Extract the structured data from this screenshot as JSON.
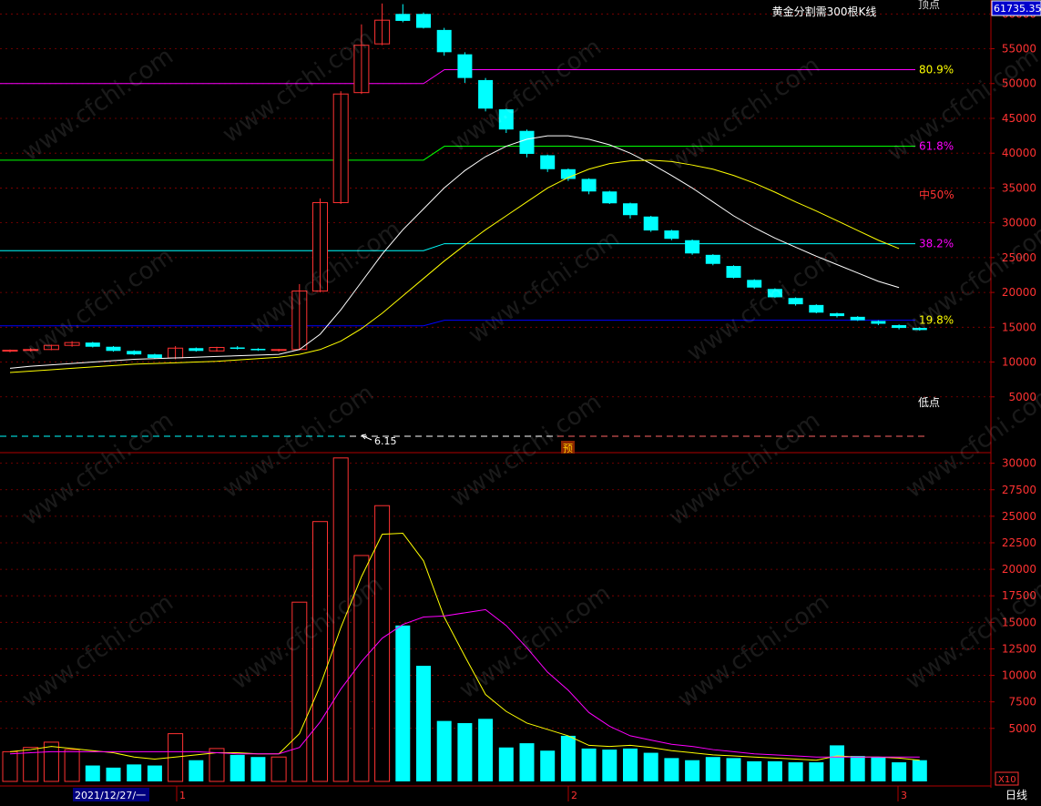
{
  "header": {
    "title": "黄金分割需300根K线",
    "price_badge": "61735.35",
    "top_label_partial": "顶点"
  },
  "watermark": "www.cfchi.com",
  "colors": {
    "background": "#000000",
    "up": "#ff3232",
    "down": "#00ffff",
    "grid": "#8b0000",
    "axis_text": "#ff3232",
    "ma_white": "#ffffff",
    "ma_yellow": "#ffff00",
    "vol_ma_yellow": "#ffff00",
    "vol_ma_magenta": "#ff00ff",
    "fib_809": "#ff00ff",
    "fib_618": "#00ff00",
    "fib_382": "#00ffff",
    "fib_198": "#0000ff"
  },
  "chart_data": [
    {
      "type": "candlestick",
      "ylim": [
        0,
        62000
      ],
      "y_ticks": [
        5000,
        10000,
        15000,
        20000,
        25000,
        30000,
        35000,
        40000,
        45000,
        50000,
        55000,
        60000
      ],
      "grid": true,
      "candles": [
        {
          "o": 11600,
          "h": 11800,
          "l": 11400,
          "c": 11700
        },
        {
          "o": 11700,
          "h": 12000,
          "l": 11500,
          "c": 11800
        },
        {
          "o": 11800,
          "h": 12500,
          "l": 11700,
          "c": 12400
        },
        {
          "o": 12400,
          "h": 13000,
          "l": 12200,
          "c": 12800
        },
        {
          "o": 12800,
          "h": 12900,
          "l": 12100,
          "c": 12200
        },
        {
          "o": 12200,
          "h": 12300,
          "l": 11500,
          "c": 11600
        },
        {
          "o": 11600,
          "h": 11700,
          "l": 11000,
          "c": 11100
        },
        {
          "o": 11100,
          "h": 11200,
          "l": 10500,
          "c": 10600
        },
        {
          "o": 10600,
          "h": 12300,
          "l": 10400,
          "c": 12000
        },
        {
          "o": 12000,
          "h": 12100,
          "l": 11500,
          "c": 11600
        },
        {
          "o": 11600,
          "h": 12200,
          "l": 11500,
          "c": 12100
        },
        {
          "o": 12100,
          "h": 12300,
          "l": 11800,
          "c": 11900
        },
        {
          "o": 11900,
          "h": 12000,
          "l": 11600,
          "c": 11700
        },
        {
          "o": 11700,
          "h": 11900,
          "l": 11500,
          "c": 11800
        },
        {
          "o": 11800,
          "h": 21200,
          "l": 11700,
          "c": 20200
        },
        {
          "o": 20200,
          "h": 33500,
          "l": 20000,
          "c": 32900
        },
        {
          "o": 32900,
          "h": 48900,
          "l": 32700,
          "c": 48500
        },
        {
          "o": 48700,
          "h": 58500,
          "l": 48500,
          "c": 55500
        },
        {
          "o": 55700,
          "h": 61500,
          "l": 55500,
          "c": 59100
        },
        {
          "o": 60000,
          "h": 61400,
          "l": 58800,
          "c": 59000
        },
        {
          "o": 60000,
          "h": 60200,
          "l": 57900,
          "c": 58000
        },
        {
          "o": 57700,
          "h": 58000,
          "l": 54000,
          "c": 54500
        },
        {
          "o": 54200,
          "h": 54500,
          "l": 50100,
          "c": 50800
        },
        {
          "o": 50500,
          "h": 50800,
          "l": 46000,
          "c": 46400
        },
        {
          "o": 46300,
          "h": 46400,
          "l": 42900,
          "c": 43400
        },
        {
          "o": 43200,
          "h": 43400,
          "l": 39400,
          "c": 39900
        },
        {
          "o": 39700,
          "h": 39800,
          "l": 37300,
          "c": 37700
        },
        {
          "o": 37700,
          "h": 37800,
          "l": 36000,
          "c": 36300
        },
        {
          "o": 36300,
          "h": 36400,
          "l": 34100,
          "c": 34500
        },
        {
          "o": 34500,
          "h": 34600,
          "l": 32700,
          "c": 32800
        },
        {
          "o": 32800,
          "h": 32900,
          "l": 30600,
          "c": 31100
        },
        {
          "o": 30900,
          "h": 31000,
          "l": 28700,
          "c": 28900
        },
        {
          "o": 28900,
          "h": 29000,
          "l": 27500,
          "c": 27700
        },
        {
          "o": 27500,
          "h": 27600,
          "l": 25400,
          "c": 25600
        },
        {
          "o": 25400,
          "h": 25500,
          "l": 23900,
          "c": 24100
        },
        {
          "o": 23800,
          "h": 23900,
          "l": 22000,
          "c": 22100
        },
        {
          "o": 21800,
          "h": 21900,
          "l": 20500,
          "c": 20700
        },
        {
          "o": 20500,
          "h": 20600,
          "l": 19200,
          "c": 19300
        },
        {
          "o": 19200,
          "h": 19300,
          "l": 18100,
          "c": 18300
        },
        {
          "o": 18200,
          "h": 18300,
          "l": 17000,
          "c": 17100
        },
        {
          "o": 17000,
          "h": 17100,
          "l": 16400,
          "c": 16600
        },
        {
          "o": 16500,
          "h": 16600,
          "l": 15900,
          "c": 16000
        },
        {
          "o": 15900,
          "h": 16000,
          "l": 15300,
          "c": 15500
        },
        {
          "o": 15300,
          "h": 15400,
          "l": 14700,
          "c": 14900
        },
        {
          "o": 14900,
          "h": 15000,
          "l": 14500,
          "c": 14600
        }
      ],
      "ma_white": [
        9100,
        9400,
        9600,
        9800,
        10000,
        10200,
        10400,
        10500,
        10600,
        10700,
        10800,
        10900,
        11000,
        11100,
        11800,
        14000,
        17500,
        21500,
        25500,
        29000,
        32000,
        35000,
        37500,
        39500,
        41000,
        42000,
        42500,
        42500,
        42000,
        41200,
        40000,
        38500,
        36800,
        35000,
        33000,
        31000,
        29300,
        27800,
        26500,
        25200,
        24000,
        22800,
        21600,
        20700
      ],
      "ma_yellow": [
        8500,
        8700,
        8900,
        9100,
        9300,
        9500,
        9700,
        9800,
        9900,
        10000,
        10100,
        10300,
        10500,
        10700,
        11100,
        11800,
        13000,
        14800,
        17000,
        19500,
        22000,
        24500,
        26800,
        29000,
        31000,
        33000,
        35000,
        36500,
        37700,
        38500,
        38900,
        39000,
        38800,
        38300,
        37700,
        36800,
        35700,
        34400,
        33000,
        31700,
        30300,
        28900,
        27500,
        26300
      ],
      "fib_levels": [
        {
          "label": "80.9%",
          "value": 52000,
          "left_value": 50000
        },
        {
          "label": "61.8%",
          "value": 41000,
          "left_value": 39000
        },
        {
          "label": "中50%",
          "value": 34000
        },
        {
          "label": "38.2%",
          "value": 27000,
          "left_value": 26000
        },
        {
          "label": "19.8%",
          "value": 16000,
          "left_value": 15200
        }
      ],
      "low_label": "低点",
      "low_value": "6.15",
      "forecast_marker": "预"
    },
    {
      "type": "bar",
      "title": "",
      "ylim": [
        0,
        31000
      ],
      "y_ticks": [
        5000,
        7500,
        10000,
        12500,
        15000,
        17500,
        20000,
        22500,
        25000,
        27500,
        30000
      ],
      "multiplier_label": "X10",
      "values": [
        2800,
        3200,
        3700,
        3000,
        1500,
        1300,
        1600,
        1500,
        4500,
        2000,
        3100,
        2500,
        2300,
        2300,
        16900,
        24500,
        30500,
        21300,
        26000,
        14700,
        10900,
        5700,
        5500,
        5900,
        3200,
        3600,
        2900,
        4300,
        3100,
        3000,
        3100,
        2700,
        2200,
        2000,
        2300,
        2200,
        1900,
        1900,
        1800,
        1800,
        3400,
        2400,
        2300,
        1800,
        2000
      ],
      "ma_yellow": [
        2800,
        3000,
        3300,
        3100,
        2900,
        2700,
        2300,
        2100,
        2300,
        2500,
        2700,
        2700,
        2600,
        2600,
        4500,
        9000,
        14500,
        19300,
        23300,
        23400,
        20800,
        15500,
        11800,
        8200,
        6600,
        5500,
        4900,
        4300,
        3400,
        3300,
        3400,
        3200,
        2900,
        2700,
        2500,
        2400,
        2300,
        2200,
        2100,
        2000,
        2400,
        2300,
        2300,
        2200,
        2000
      ],
      "ma_magenta": [
        2600,
        2700,
        2800,
        2800,
        2800,
        2800,
        2800,
        2800,
        2800,
        2800,
        2700,
        2600,
        2600,
        2600,
        3200,
        5600,
        8700,
        11300,
        13500,
        14800,
        15500,
        15600,
        15900,
        16200,
        14700,
        12600,
        10300,
        8600,
        6500,
        5200,
        4300,
        3900,
        3500,
        3300,
        3000,
        2800,
        2600,
        2500,
        2400,
        2300,
        2300,
        2300,
        2300,
        2300,
        2300
      ]
    }
  ],
  "x_axis": {
    "date_label": "2021/12/27/一",
    "month_markers": [
      "1",
      "2",
      "3"
    ]
  },
  "footer": {
    "period_label": "日线"
  }
}
